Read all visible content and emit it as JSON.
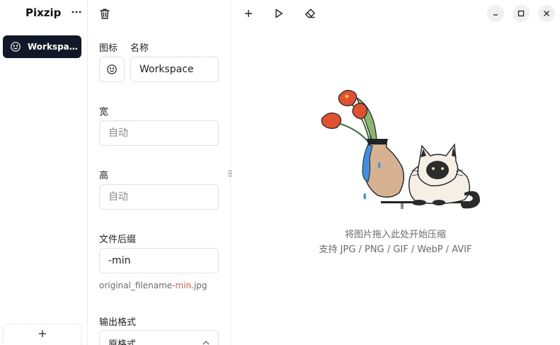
{
  "sidebar": {
    "brand": "Pixzip",
    "workspace": {
      "label": "Workspace"
    }
  },
  "panel": {
    "icon_label": "图标",
    "name_label": "名称",
    "name_value": "Workspace",
    "width_label": "宽",
    "width_placeholder": "自动",
    "height_label": "高",
    "height_placeholder": "自动",
    "suffix_label": "文件后缀",
    "suffix_value": "-min",
    "filename_example": {
      "prefix": "original_filename",
      "suffix": "-min",
      "ext": ".jpg"
    },
    "format_label": "输出格式",
    "format_value": "原格式"
  },
  "main": {
    "drop_title": "将图片拖入此处开始压缩",
    "drop_formats": "支持 JPG / PNG / GIF / WebP / AVIF"
  },
  "icons": {
    "more": "more-horizontal-icon",
    "workspace": "smiley-icon",
    "add": "plus-icon",
    "trash": "trash-icon",
    "start": "play-icon",
    "clear": "eraser-icon"
  },
  "colors": {
    "active_bg": "#111827",
    "accent": "#e05b4b",
    "muted_text": "#6b6b6b"
  }
}
